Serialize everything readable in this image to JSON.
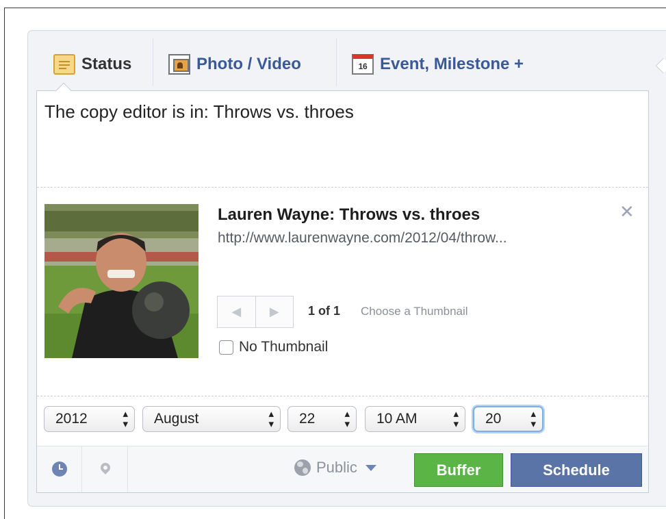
{
  "tabs": [
    {
      "label": "Status",
      "icon": "status-icon",
      "active": true
    },
    {
      "label": "Photo / Video",
      "icon": "photo-icon"
    },
    {
      "label": "Event, Milestone +",
      "icon": "calendar-icon",
      "icon_text": "16"
    }
  ],
  "composer": {
    "text": "The copy editor is in: Throws vs. throes"
  },
  "link_preview": {
    "title": "Lauren Wayne: Throws vs. throes",
    "url": "http://www.laurenwayne.com/2012/04/throw...",
    "remove": "✕",
    "pager_prev": "◀",
    "pager_next": "▶",
    "count_current": "1",
    "count_rest": "of 1",
    "choose_label": "Choose a Thumbnail",
    "no_thumbnail_label": "No Thumbnail",
    "no_thumbnail_checked": false
  },
  "schedule": {
    "year": "2012",
    "month": "August",
    "day": "22",
    "hour": "10 AM",
    "minute": "20",
    "arrows": "▲▼"
  },
  "footer": {
    "audience": "Public",
    "buffer_label": "Buffer",
    "schedule_label": "Schedule"
  },
  "colors": {
    "accent_blue": "#3b5998",
    "buffer_green": "#5ab446",
    "schedule_blue": "#5b74a8"
  }
}
